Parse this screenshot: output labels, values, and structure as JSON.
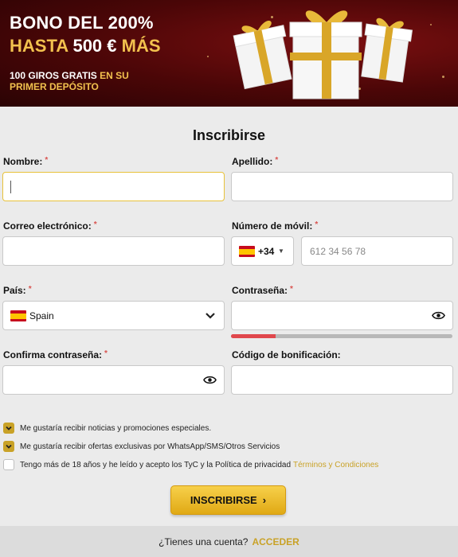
{
  "banner": {
    "line1": "BONO DEL 200%",
    "line2_a": "HASTA ",
    "line2_b": "500 €",
    "line2_c": " MÁS",
    "line3_a": "100 GIROS GRATIS",
    "line3_b": " EN SU PRIMER DEPÓSITO"
  },
  "form": {
    "title": "Inscribirse",
    "fields": {
      "nombre": {
        "label": "Nombre:",
        "value": ""
      },
      "apellido": {
        "label": "Apellido:",
        "value": ""
      },
      "correo": {
        "label": "Correo electrónico:",
        "value": ""
      },
      "movil": {
        "label": "Número de móvil:",
        "prefix": "+34",
        "placeholder": "612 34 56 78"
      },
      "pais": {
        "label": "País:",
        "value": "Spain"
      },
      "contrasena": {
        "label": "Contraseña:",
        "value": "",
        "strength": 0.2
      },
      "confirma": {
        "label": "Confirma contraseña:",
        "value": ""
      },
      "codigo": {
        "label": "Código de bonificación:",
        "value": ""
      }
    },
    "required_mark": "*",
    "checkboxes": [
      {
        "label": "Me gustaría recibir noticias y promociones especiales.",
        "checked": true
      },
      {
        "label": "Me gustaría recibir ofertas exclusivas por WhatsApp/SMS/Otros Servicios",
        "checked": true
      },
      {
        "label": "Tengo más de 18 años y he leído y acepto los TyC y la Política de privacidad",
        "link": "Términos y Condiciones",
        "checked": false
      }
    ],
    "submit_label": "INSCRIBIRSE",
    "submit_arrow": "›"
  },
  "footer": {
    "question": "¿Tienes una cuenta?",
    "link": "ACCEDER"
  },
  "colors": {
    "accent": "#c9a227",
    "banner_bg": "#4a0607",
    "strength_fill": "#e0474c"
  }
}
